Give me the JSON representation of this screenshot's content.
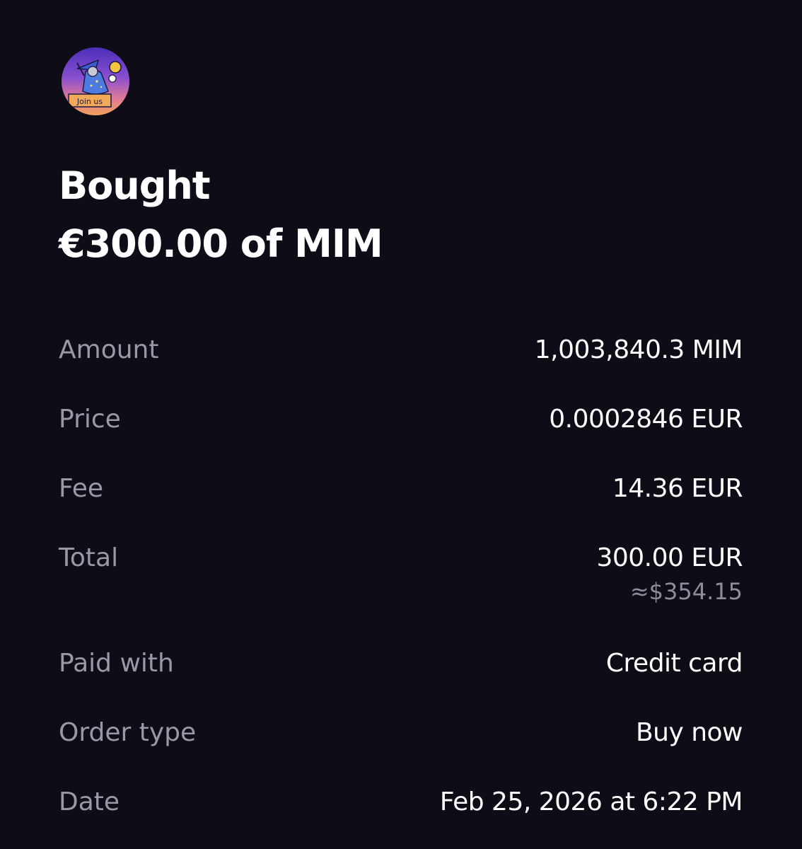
{
  "header": {
    "avatar_icon": "wizard-join-us-avatar",
    "avatar_caption": "Join us",
    "title_action": "Bought",
    "title_detail": "€300.00 of MIM"
  },
  "details": {
    "amount": {
      "label": "Amount",
      "value": "1,003,840.3 MIM"
    },
    "price": {
      "label": "Price",
      "value": "0.0002846 EUR"
    },
    "fee": {
      "label": "Fee",
      "value": "14.36 EUR"
    },
    "total": {
      "label": "Total",
      "value": "300.00 EUR",
      "approx": "≈$354.15"
    },
    "paid_with": {
      "label": "Paid with",
      "value": "Credit card"
    },
    "order_type": {
      "label": "Order type",
      "value": "Buy now"
    },
    "date": {
      "label": "Date",
      "value": "Feb 25, 2026 at 6:22 PM"
    }
  },
  "colors": {
    "background": "#0e0c16",
    "primary_text": "#ffffff",
    "secondary_text": "#9a98a6"
  }
}
